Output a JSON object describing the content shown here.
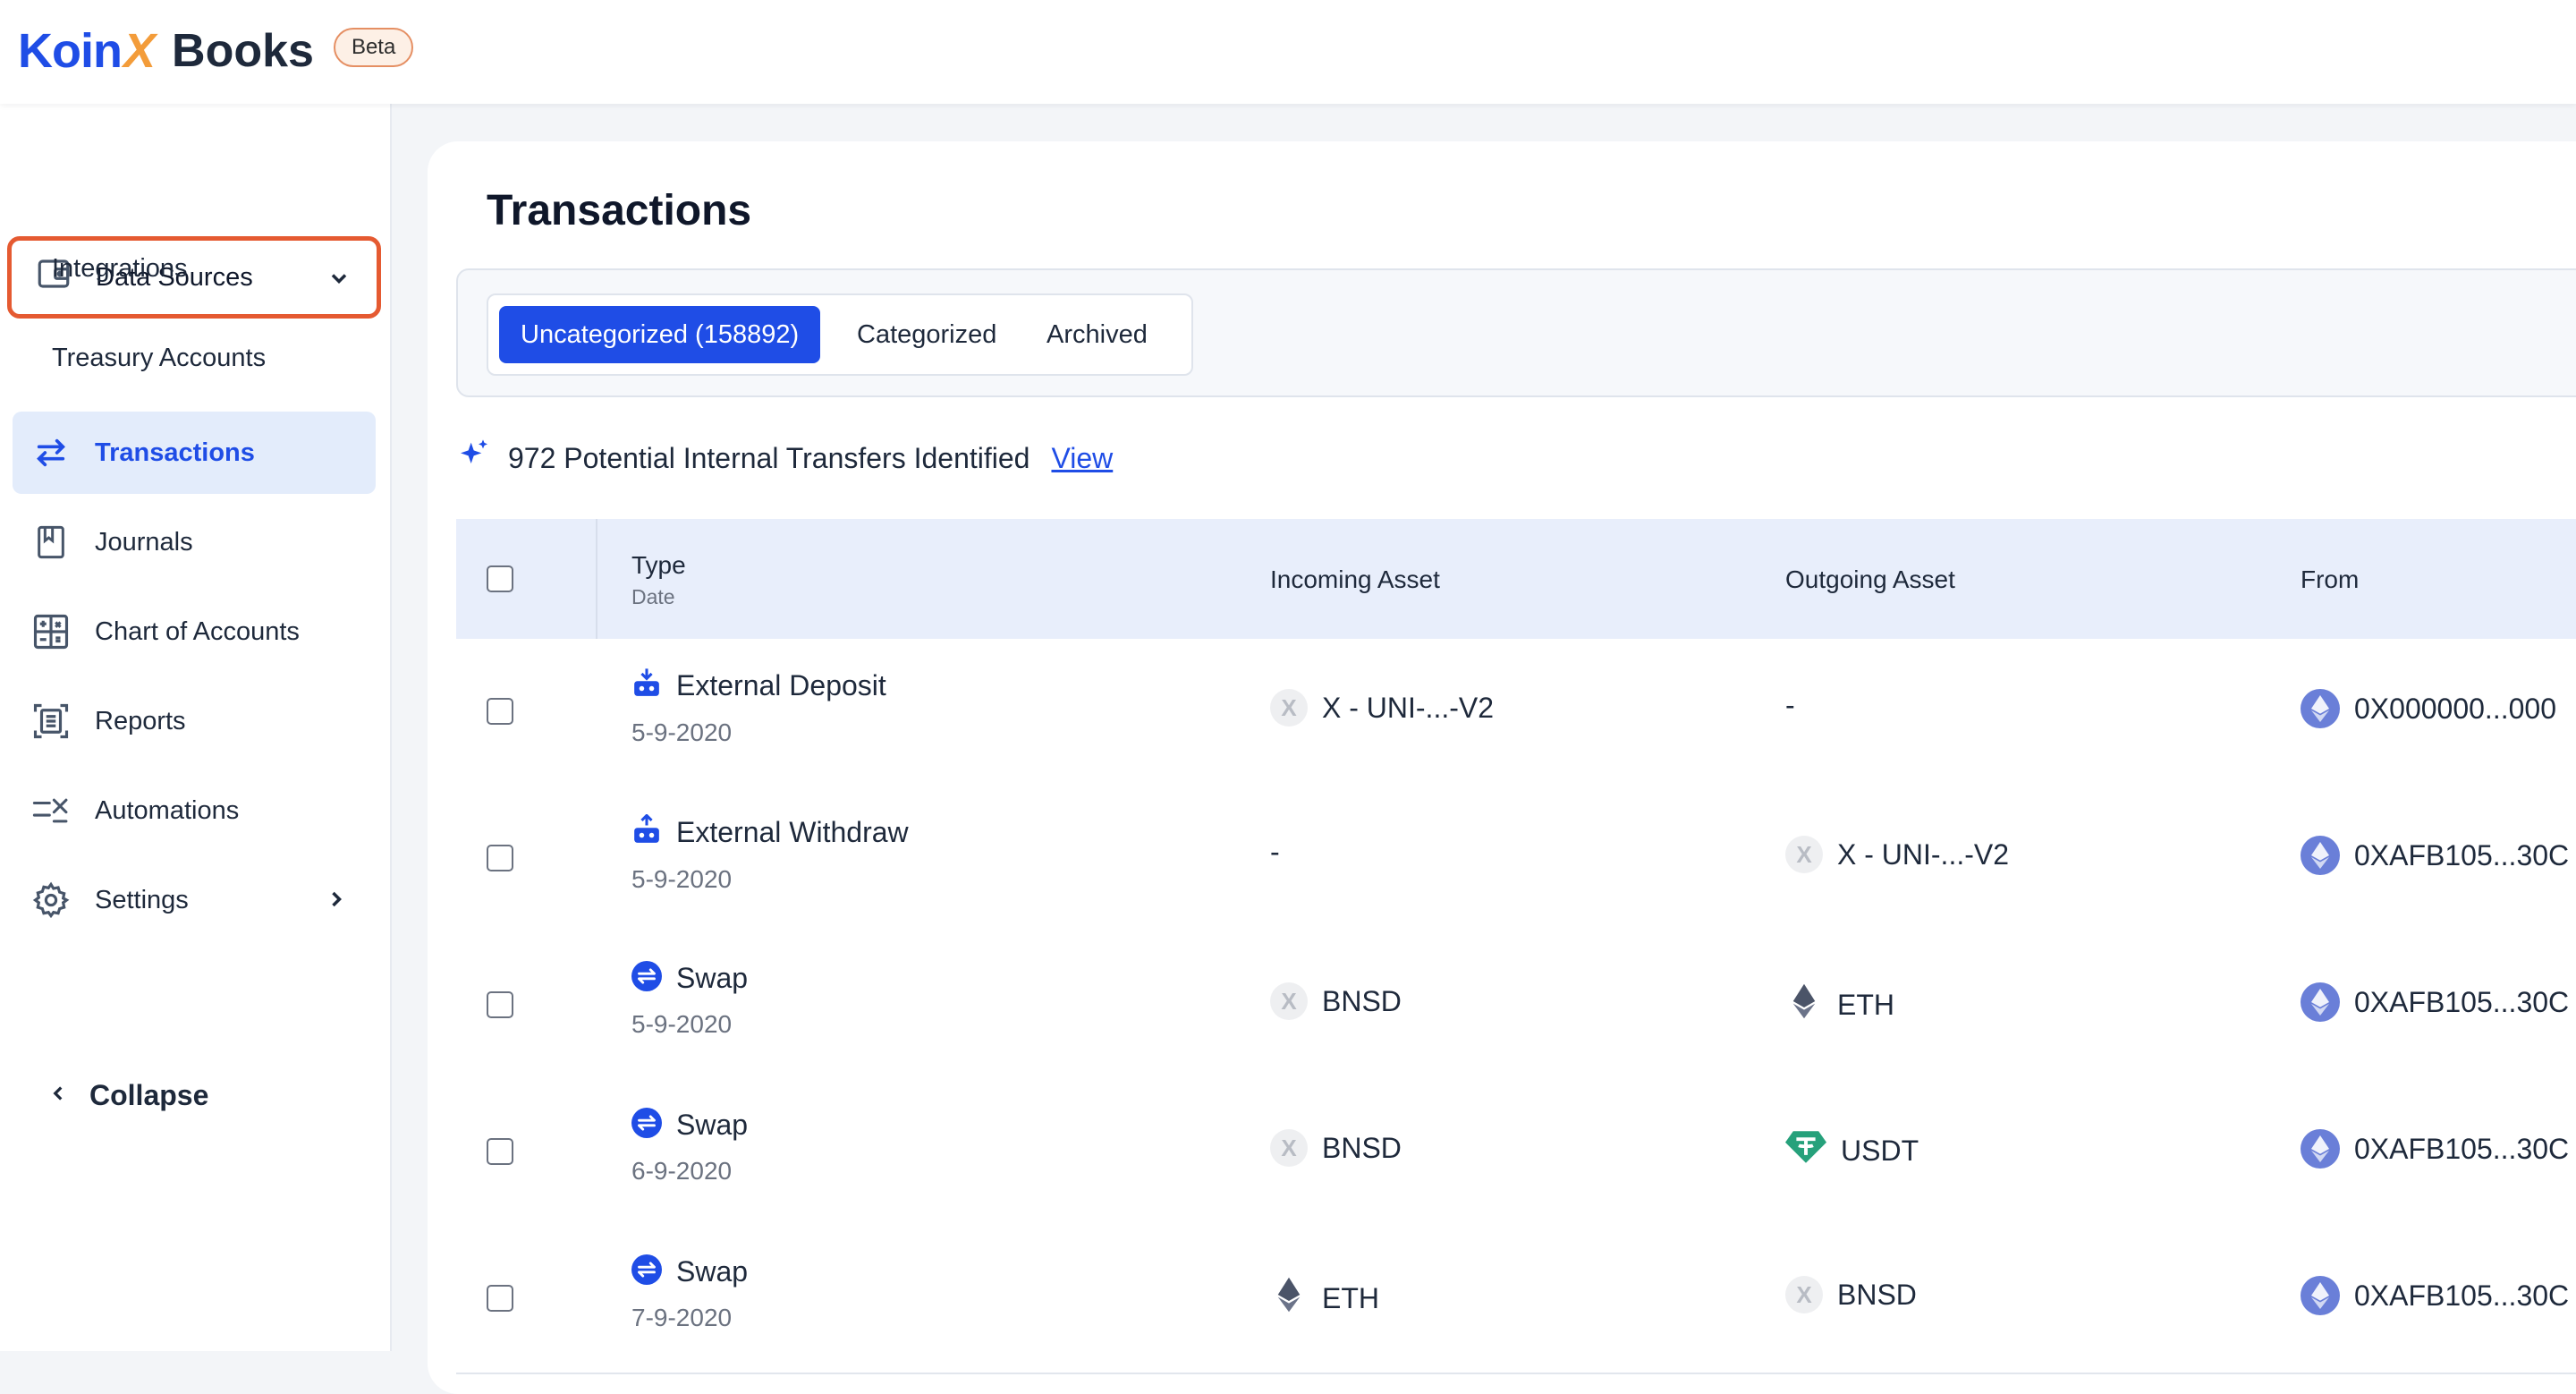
{
  "brand": {
    "koin": "Koin",
    "x": "X",
    "books": "Books",
    "beta": "Beta"
  },
  "sidebar": {
    "data_sources": "Data Sources",
    "sub_items": [
      "Integrations",
      "Treasury Accounts"
    ],
    "items": [
      {
        "label": "Transactions",
        "icon": "transfer-arrows-icon"
      },
      {
        "label": "Journals",
        "icon": "bookmark-book-icon"
      },
      {
        "label": "Chart of Accounts",
        "icon": "calculator-icon"
      },
      {
        "label": "Reports",
        "icon": "report-icon"
      },
      {
        "label": "Automations",
        "icon": "automation-icon"
      },
      {
        "label": "Settings",
        "icon": "gear-icon"
      }
    ],
    "collapse": "Collapse"
  },
  "main": {
    "title": "Transactions",
    "tabs": [
      {
        "label": "Uncategorized (158892)",
        "active": true
      },
      {
        "label": "Categorized",
        "active": false
      },
      {
        "label": "Archived",
        "active": false
      }
    ],
    "notice": {
      "text": "972 Potential Internal Transfers Identified",
      "link": "View"
    }
  },
  "table": {
    "headers": {
      "type": "Type",
      "date": "Date",
      "incoming": "Incoming Asset",
      "outgoing": "Outgoing Asset",
      "from": "From"
    },
    "rows": [
      {
        "type": "External Deposit",
        "type_icon": "deposit-icon",
        "date": "5-9-2020",
        "incoming": "X - UNI-...-V2",
        "incoming_icon": "gray",
        "outgoing": "-",
        "outgoing_icon": "none",
        "from": "0X000000...000"
      },
      {
        "type": "External Withdraw",
        "type_icon": "withdraw-icon",
        "date": "5-9-2020",
        "incoming": "-",
        "incoming_icon": "none",
        "outgoing": "X - UNI-...-V2",
        "outgoing_icon": "gray",
        "from": "0XAFB105...30C"
      },
      {
        "type": "Swap",
        "type_icon": "swap-icon",
        "date": "5-9-2020",
        "incoming": "BNSD",
        "incoming_icon": "gray",
        "outgoing": "ETH",
        "outgoing_icon": "eth",
        "from": "0XAFB105...30C"
      },
      {
        "type": "Swap",
        "type_icon": "swap-icon",
        "date": "6-9-2020",
        "incoming": "BNSD",
        "incoming_icon": "gray",
        "outgoing": "USDT",
        "outgoing_icon": "usdt",
        "from": "0XAFB105...30C"
      },
      {
        "type": "Swap",
        "type_icon": "swap-icon",
        "date": "7-9-2020",
        "incoming": "ETH",
        "incoming_icon": "eth",
        "outgoing": "BNSD",
        "outgoing_icon": "gray",
        "from": "0XAFB105...30C"
      }
    ]
  },
  "colors": {
    "accent": "#1f4de6",
    "highlight_border": "#e55a31",
    "beta_bg": "#fdf0e6",
    "logo_x": "#f39c3a"
  }
}
